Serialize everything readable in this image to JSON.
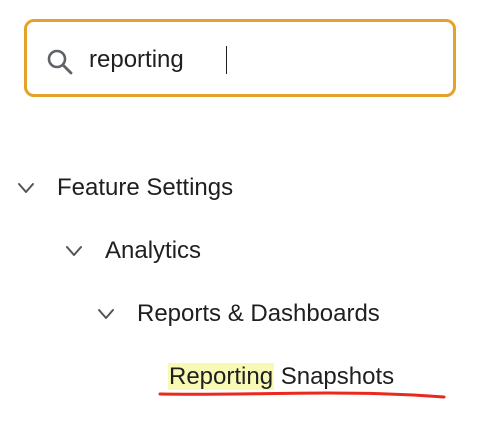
{
  "search": {
    "value": "reporting",
    "icon": "search-icon",
    "border_color": "#e5a22a"
  },
  "tree": {
    "items": [
      {
        "label": "Feature Settings",
        "expanded": true,
        "icon": "chevron-down-icon"
      },
      {
        "label": "Analytics",
        "expanded": true,
        "icon": "chevron-down-icon"
      },
      {
        "label": "Reports & Dashboards",
        "expanded": true,
        "icon": "chevron-down-icon"
      },
      {
        "label_match": "Reporting",
        "label_rest": " Snapshots"
      }
    ]
  },
  "colors": {
    "highlight": "#f8f9b5",
    "annotation": "#e8291c"
  }
}
